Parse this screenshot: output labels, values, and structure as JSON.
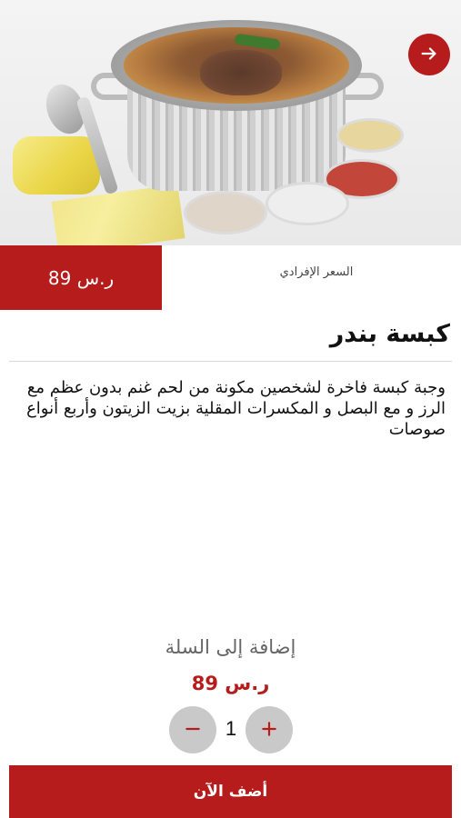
{
  "product": {
    "image_icon": "kabsa-dish-photo",
    "title": "كبسة بندر",
    "description": "وجبة كبسة فاخرة لشخصين مكونة من لحم غنم بدون عظم مع الرز و مع البصل و المكسرات المقلية بزيت الزيتون وأربع أنواع صوصات"
  },
  "nav": {
    "icon": "arrow-right-icon"
  },
  "price": {
    "value": "89 ر.س",
    "label": "السعر الإفرادي"
  },
  "cart": {
    "add_to_cart_label": "إضافة إلى السلة",
    "total": "89 ر.س",
    "quantity": "1",
    "minus_icon": "minus-icon",
    "plus_icon": "plus-icon",
    "add_now_label": "أضف الآن"
  },
  "colors": {
    "accent": "#b71c1c",
    "stepper_bg": "#c9c9c9"
  }
}
